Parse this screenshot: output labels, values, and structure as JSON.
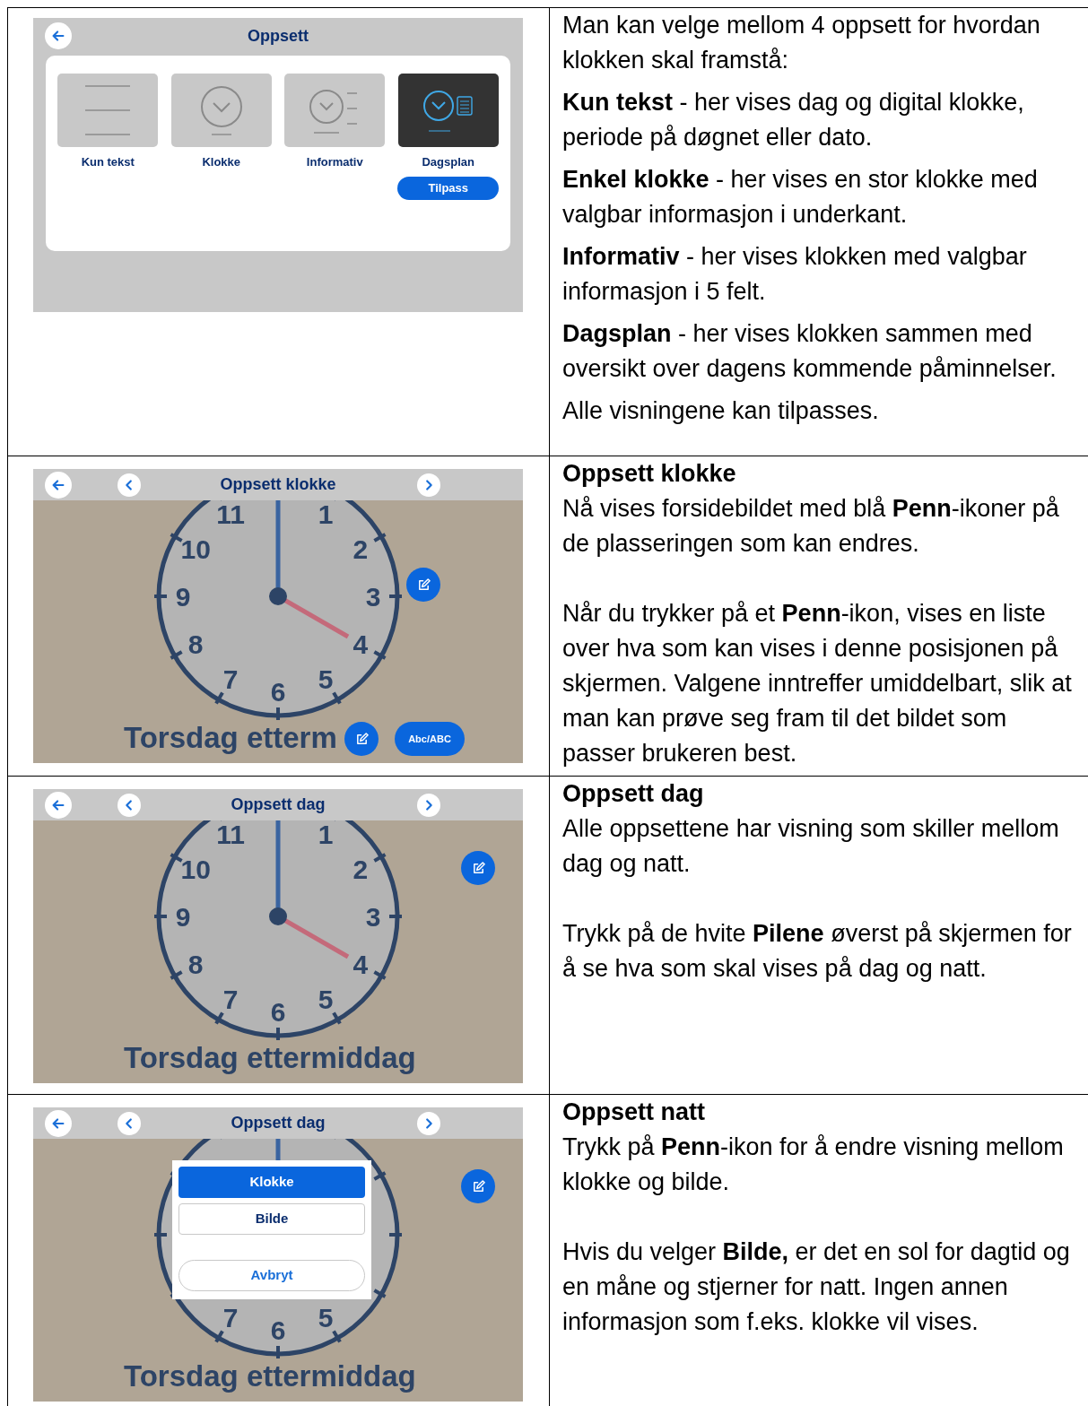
{
  "rows": [
    {
      "screen": {
        "kind": "layout_picker",
        "title": "Oppsett",
        "options": [
          {
            "label": "Kun tekst",
            "kind": "text",
            "selected": false
          },
          {
            "label": "Klokke",
            "kind": "clock",
            "selected": false
          },
          {
            "label": "Informativ",
            "kind": "info",
            "selected": false
          },
          {
            "label": "Dagsplan",
            "kind": "dayplan",
            "selected": true
          }
        ],
        "button": "Tilpass"
      },
      "text": [
        {
          "kind": "paragraph",
          "text": "Man kan velge mellom 4 oppsett for hvordan klokken skal framstå:"
        },
        {
          "kind": "paragraph",
          "text": "**Kun tekst** - her vises dag og digital klokke, periode på døgnet eller dato."
        },
        {
          "kind": "paragraph",
          "text": "**Enkel klokke** - her vises en stor klokke med valgbar informasjon i underkant."
        },
        {
          "kind": "paragraph",
          "text": "**Informativ** - her vises klokken med valgbar informasjon i 5 felt."
        },
        {
          "kind": "paragraph",
          "text": "**Dagsplan** - her vises klokken sammen med oversikt over dagens kommende påminnelser."
        },
        {
          "kind": "paragraph",
          "text": "Alle visningene kan tilpasses."
        }
      ]
    },
    {
      "screen": {
        "kind": "clock",
        "title": "Oppsett klokke",
        "numerals": [
          {
            "kind": "h11",
            "text": "11"
          },
          {
            "kind": "h1",
            "text": "1"
          },
          {
            "kind": "h10",
            "text": "10"
          },
          {
            "kind": "h2",
            "text": "2"
          },
          {
            "kind": "h9",
            "text": "9"
          },
          {
            "kind": "h3",
            "text": "3"
          },
          {
            "kind": "h8",
            "text": "8"
          },
          {
            "kind": "h4",
            "text": "4"
          },
          {
            "kind": "h7",
            "text": "7"
          },
          {
            "kind": "h5",
            "text": "5"
          },
          {
            "kind": "h6",
            "text": "6"
          }
        ],
        "caption": "Torsdag etterm",
        "pen_buttons": [
          {
            "kind": "side"
          },
          {
            "kind": "caption"
          }
        ],
        "format_button": "Abc/ABC"
      },
      "text": [
        {
          "kind": "heading",
          "text": "Oppsett klokke"
        },
        {
          "kind": "paragraph",
          "text": "Nå vises forsidebildet med blå **Penn**-ikoner på de plasseringen som kan endres."
        },
        {
          "kind": "paragraph",
          "text": "Når du trykker på et **Penn**-ikon, vises en liste over hva som kan vises i denne posisjonen på skjermen. Valgene inntreffer umiddelbart, slik at man kan prøve seg fram til det bildet som passer brukeren best."
        }
      ]
    },
    {
      "screen": {
        "kind": "clock",
        "title": "Oppsett dag",
        "numerals": [
          {
            "kind": "h11",
            "text": "11"
          },
          {
            "kind": "h1",
            "text": "1"
          },
          {
            "kind": "h10",
            "text": "10"
          },
          {
            "kind": "h2",
            "text": "2"
          },
          {
            "kind": "h9",
            "text": "9"
          },
          {
            "kind": "h3",
            "text": "3"
          },
          {
            "kind": "h8",
            "text": "8"
          },
          {
            "kind": "h4",
            "text": "4"
          },
          {
            "kind": "h7",
            "text": "7"
          },
          {
            "kind": "h5",
            "text": "5"
          },
          {
            "kind": "h6",
            "text": "6"
          }
        ],
        "caption": "Torsdag ettermiddag",
        "pen_buttons": [
          {
            "kind": "corner"
          }
        ]
      },
      "text": [
        {
          "kind": "heading",
          "text": "Oppsett dag"
        },
        {
          "kind": "paragraph",
          "text": "Alle oppsettene har visning som skiller mellom dag og natt."
        },
        {
          "kind": "paragraph",
          "text": "Trykk på de hvite **Pilene** øverst på skjermen for å se hva som skal vises på dag og natt."
        }
      ]
    },
    {
      "screen": {
        "kind": "clock",
        "title": "Oppsett dag",
        "numerals": [
          {
            "kind": "h7",
            "text": "7"
          },
          {
            "kind": "h5",
            "text": "5"
          },
          {
            "kind": "h6",
            "text": "6"
          }
        ],
        "caption": "Torsdag ettermiddag",
        "pen_buttons": [
          {
            "kind": "corner"
          }
        ],
        "menu": {
          "options": [
            {
              "label": "Klokke",
              "selected": true
            },
            {
              "label": "Bilde",
              "selected": false
            }
          ],
          "cancel": "Avbryt"
        }
      },
      "text": [
        {
          "kind": "heading",
          "text": "Oppsett natt"
        },
        {
          "kind": "paragraph",
          "text": "Trykk på **Penn**-ikon for å endre visning mellom klokke og bilde."
        },
        {
          "kind": "paragraph",
          "text": "Hvis du velger **Bilde,** er det en sol for dagtid og en måne og stjerner for natt. Ingen annen informasjon som f.eks. klokke vil vises."
        }
      ]
    }
  ]
}
